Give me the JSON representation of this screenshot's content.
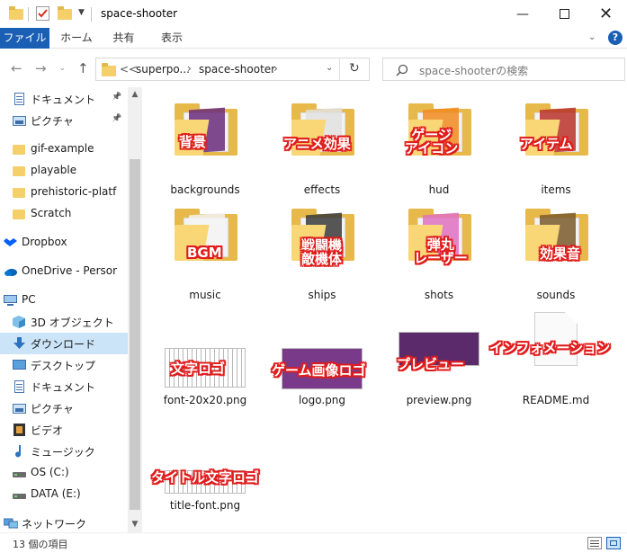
{
  "window": {
    "title": "space-shooter"
  },
  "ribbon": {
    "tabs": [
      "ファイル",
      "ホーム",
      "共有",
      "表示"
    ],
    "active_tab": 0,
    "help_label": "?"
  },
  "address": {
    "overflow": "<<",
    "crumbs": [
      "superpo...",
      "space-shooter"
    ]
  },
  "search": {
    "placeholder": "space-shooterの検索"
  },
  "sidebar": {
    "items": [
      {
        "label": "ドキュメント",
        "icon": "document-icon",
        "pinned": true
      },
      {
        "label": "ピクチャ",
        "icon": "picture-icon",
        "pinned": true
      },
      {
        "label": "gif-example",
        "icon": "folder-icon",
        "pinned": false
      },
      {
        "label": "playable",
        "icon": "folder-icon",
        "pinned": false
      },
      {
        "label": "prehistoric-platf",
        "icon": "folder-icon",
        "pinned": false
      },
      {
        "label": "Scratch",
        "icon": "folder-icon",
        "pinned": false
      },
      {
        "label": "Dropbox",
        "icon": "dropbox-icon",
        "pinned": false
      },
      {
        "label": "OneDrive - Persor",
        "icon": "onedrive-icon",
        "pinned": false
      },
      {
        "label": "PC",
        "icon": "pc-icon",
        "pinned": false
      },
      {
        "label": "3D オブジェクト",
        "icon": "3d-objects-icon",
        "pinned": false
      },
      {
        "label": "ダウンロード",
        "icon": "download-icon",
        "pinned": false,
        "selected": true
      },
      {
        "label": "デスクトップ",
        "icon": "desktop-icon",
        "pinned": false
      },
      {
        "label": "ドキュメント",
        "icon": "document-icon",
        "pinned": false
      },
      {
        "label": "ピクチャ",
        "icon": "picture-icon",
        "pinned": false
      },
      {
        "label": "ビデオ",
        "icon": "video-icon",
        "pinned": false
      },
      {
        "label": "ミュージック",
        "icon": "music-icon",
        "pinned": false
      },
      {
        "label": "OS (C:)",
        "icon": "drive-icon",
        "pinned": false
      },
      {
        "label": "DATA (E:)",
        "icon": "drive-icon",
        "pinned": false
      },
      {
        "label": "ネットワーク",
        "icon": "network-icon",
        "pinned": false
      }
    ]
  },
  "files": [
    {
      "name": "backgrounds",
      "kind": "folder",
      "annotation": "背景",
      "accent": "#6a2a7a"
    },
    {
      "name": "effects",
      "kind": "folder",
      "annotation": "アニメ効果",
      "accent": "#e0e0e0"
    },
    {
      "name": "hud",
      "kind": "folder",
      "annotation": "ゲージ\nアイコン",
      "accent": "#f08a1e"
    },
    {
      "name": "items",
      "kind": "folder",
      "annotation": "アイテム",
      "accent": "#b8322a"
    },
    {
      "name": "music",
      "kind": "folder",
      "annotation": "BGM",
      "accent": "#f3f3f3"
    },
    {
      "name": "ships",
      "kind": "folder",
      "annotation": "戦闘機\n敵機体",
      "accent": "#3a3a3a"
    },
    {
      "name": "shots",
      "kind": "folder",
      "annotation": "弾丸\nレーザー",
      "accent": "#e070c0"
    },
    {
      "name": "sounds",
      "kind": "folder",
      "annotation": "効果音",
      "accent": "#7a5a2a"
    },
    {
      "name": "font-20x20.png",
      "kind": "image",
      "annotation": "文字ロゴ",
      "accent": "#d0d0d0"
    },
    {
      "name": "logo.png",
      "kind": "image",
      "annotation": "ゲーム画像ロゴ",
      "accent": "#7a3a8a"
    },
    {
      "name": "preview.png",
      "kind": "image",
      "annotation": "プレビュー",
      "accent": "#5a2a6a"
    },
    {
      "name": "README.md",
      "kind": "document",
      "annotation": "インフォメーション",
      "accent": "#f0f0f0"
    },
    {
      "name": "title-font.png",
      "kind": "image",
      "annotation": "タイトル文字ロゴ",
      "accent": "#d8d8d8"
    }
  ],
  "status": {
    "item_count": "13 個の項目"
  },
  "colors": {
    "ribbon_active": "#1a5fb4",
    "selection": "#cce4f7",
    "annotation_outline": "#e01c1c",
    "folder": "#f9d777"
  }
}
